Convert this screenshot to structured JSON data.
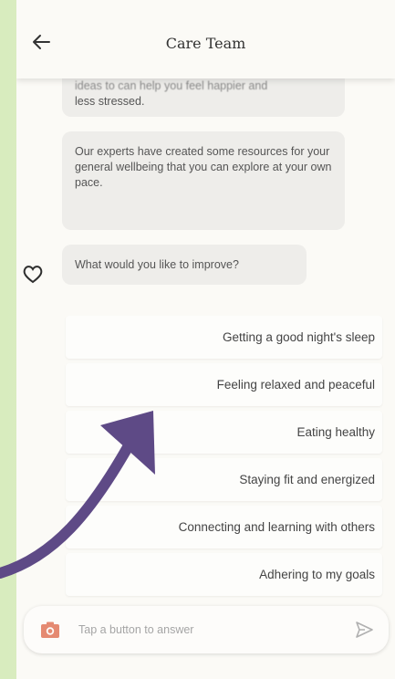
{
  "header": {
    "title": "Care Team",
    "back_icon": "arrow-left-icon"
  },
  "messages": [
    {
      "partial_line": "ideas to can help you feel happier and",
      "text": "less stressed."
    },
    {
      "text": "Our experts have created some resources for your general wellbeing that you can explore at your own pace."
    },
    {
      "text": "What would you like to improve?"
    }
  ],
  "bot_avatar_icon": "heart-outline-icon",
  "options": [
    {
      "label": "Getting a good night's sleep"
    },
    {
      "label": "Feeling relaxed and peaceful"
    },
    {
      "label": "Eating healthy"
    },
    {
      "label": "Staying fit and energized"
    },
    {
      "label": "Connecting and learning with others"
    },
    {
      "label": "Adhering to my goals"
    }
  ],
  "composer": {
    "placeholder": "Tap a button to answer",
    "camera_icon": "camera-icon",
    "send_icon": "send-icon"
  },
  "colors": {
    "background": "#dcefc5",
    "camera": "#e58a72",
    "annotation_arrow": "#5e4a86"
  }
}
